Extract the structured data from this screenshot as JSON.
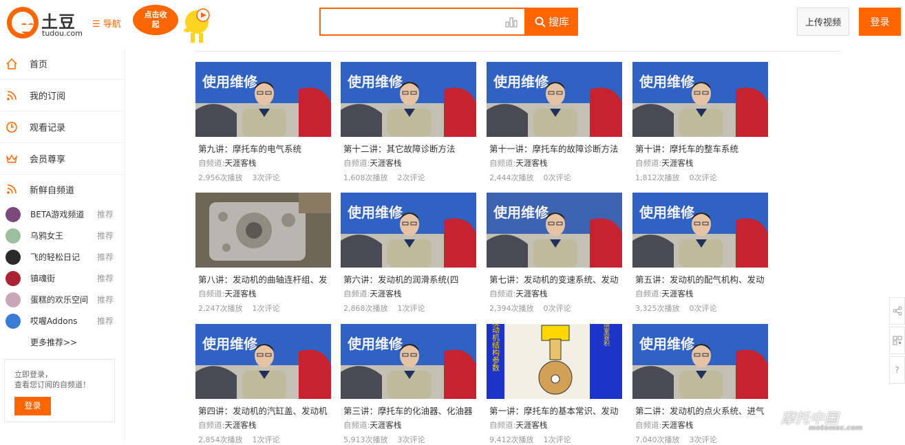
{
  "header": {
    "brand_cn": "土豆",
    "brand_en": "tudou.com",
    "nav_label": "导航",
    "promo_text": "点击收起",
    "search": {
      "placeholder": "",
      "button_label": "搜库"
    },
    "upload_label": "上传视频",
    "login_label": "登录"
  },
  "sidebar": {
    "items": [
      {
        "label": "首页",
        "icon": "home-icon"
      },
      {
        "label": "我的订阅",
        "icon": "rss-icon"
      },
      {
        "label": "观看记录",
        "icon": "clock-icon"
      },
      {
        "label": "会员尊享",
        "icon": "crown-icon"
      }
    ],
    "section_title": "新鲜自频道",
    "channels": [
      {
        "name": "BETA游戏频道",
        "tag": "推荐",
        "color": "#7a4a7a"
      },
      {
        "name": "乌鸦女王",
        "tag": "推荐",
        "color": "#9cbfa0"
      },
      {
        "name": "飞的轻松日记",
        "tag": "推荐",
        "color": "#2a2a2a"
      },
      {
        "name": "镇魂街",
        "tag": "推荐",
        "color": "#a23"
      },
      {
        "name": "蛋糕的欢乐空间",
        "tag": "推荐",
        "color": "#c9a6b8"
      },
      {
        "name": "哎喔Addons",
        "tag": "推荐",
        "color": "#3a7bd5"
      }
    ],
    "more_label": "更多推荐>>",
    "login_prompt_line1": "立即登录，",
    "login_prompt_line2": "查看您订阅的自频道！",
    "login_button": "登录"
  },
  "videos": [
    {
      "title": "第九讲：摩托车的电气系统",
      "channel_label": "自频道:",
      "channel": "天涯客栈",
      "plays": "2,956次播放",
      "comments": "3次评论",
      "thumb": "presenter"
    },
    {
      "title": "第十二讲：其它故障诊断方法",
      "channel_label": "自频道:",
      "channel": "天涯客栈",
      "plays": "1,608次播放",
      "comments": "2次评论",
      "thumb": "presenter"
    },
    {
      "title": "第十一讲：摩托车的故障诊断方法",
      "channel_label": "自频道:",
      "channel": "天涯客栈",
      "plays": "2,444次播放",
      "comments": "0次评论",
      "thumb": "presenter"
    },
    {
      "title": "第十讲：摩托车的整车系统",
      "channel_label": "自频道:",
      "channel": "天涯客栈",
      "plays": "1,812次播放",
      "comments": "0次评论",
      "thumb": "presenter"
    },
    {
      "title": "第八讲：发动机的曲轴连杆组、发",
      "channel_label": "自频道:",
      "channel": "天涯客栈",
      "plays": "2,247次播放",
      "comments": "1次评论",
      "thumb": "engine"
    },
    {
      "title": "第六讲：发动机的润滑系统(四",
      "channel_label": "自频道:",
      "channel": "天涯客栈",
      "plays": "2,868次播放",
      "comments": "1次评论",
      "thumb": "presenter"
    },
    {
      "title": "第七讲：发动机的变速系统、发动",
      "channel_label": "自频道:",
      "channel": "天涯客栈",
      "plays": "2,394次播放",
      "comments": "0次评论",
      "thumb": "workshop"
    },
    {
      "title": "第五讲：发动机的配气机构、发动",
      "channel_label": "自频道:",
      "channel": "天涯客栈",
      "plays": "3,325次播放",
      "comments": "0次评论",
      "thumb": "presenter"
    },
    {
      "title": "第四讲：发动机的汽缸盖、发动机",
      "channel_label": "自频道:",
      "channel": "天涯客栈",
      "plays": "2,854次播放",
      "comments": "1次评论",
      "thumb": "presenter"
    },
    {
      "title": "第三讲：摩托车的化油器、化油器",
      "channel_label": "自频道:",
      "channel": "天涯客栈",
      "plays": "5,913次播放",
      "comments": "3次评论",
      "thumb": "presenter"
    },
    {
      "title": "第一讲：摩托车的基本常识、发动",
      "channel_label": "自频道:",
      "channel": "天涯客栈",
      "plays": "9,412次播放",
      "comments": "1次评论",
      "thumb": "diagram"
    },
    {
      "title": "第二讲：发动机的点火系统、进气",
      "channel_label": "自频道:",
      "channel": "天涯客栈",
      "plays": "7,040次播放",
      "comments": "3次评论",
      "thumb": "presenter"
    }
  ],
  "thumb_text": {
    "banner": "使用维修",
    "diagram": "二冲程发动机结构参数",
    "diagram_side": "燃烧室容积"
  },
  "right_tools": [
    {
      "icon": "share-icon"
    },
    {
      "icon": "qrcode-icon"
    },
    {
      "icon": "help-icon",
      "label": "?"
    }
  ],
  "watermark": {
    "cn": "摩托中国",
    "en": "motomsc.com"
  },
  "colors": {
    "accent": "#ff6600"
  }
}
